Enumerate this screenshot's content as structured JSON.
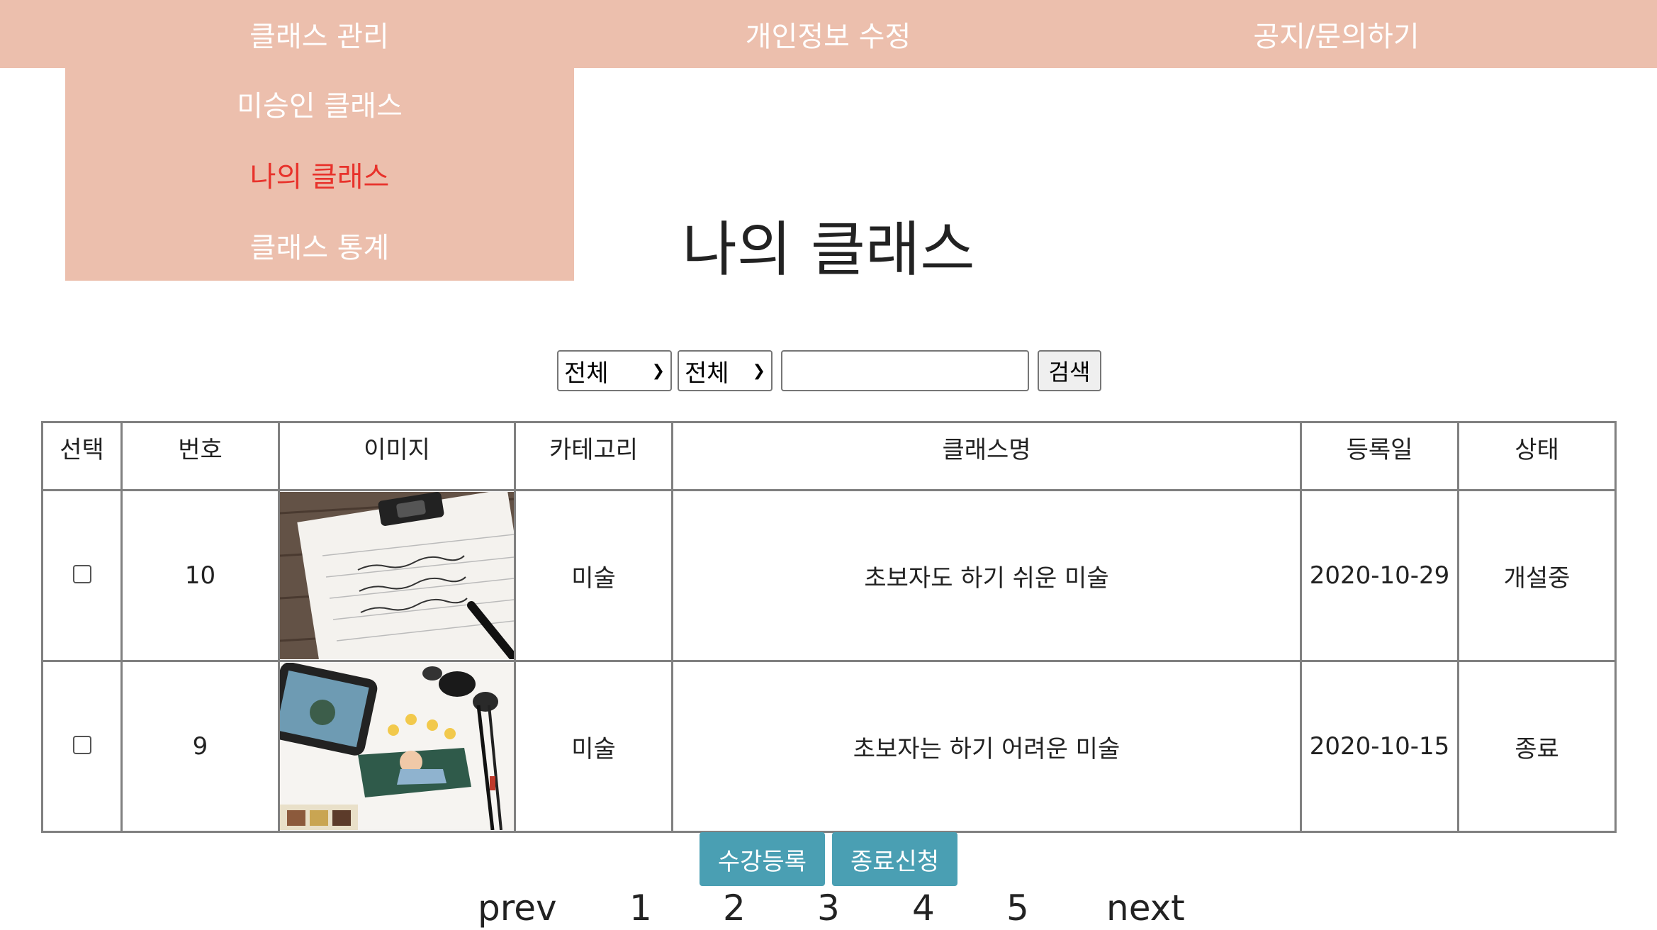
{
  "nav": {
    "items": [
      {
        "label": "클래스 관리"
      },
      {
        "label": "개인정보 수정"
      },
      {
        "label": "공지/문의하기"
      }
    ],
    "dropdown": [
      {
        "label": "미승인 클래스"
      },
      {
        "label": "나의 클래스"
      },
      {
        "label": "클래스 통계"
      }
    ]
  },
  "page": {
    "title": "나의 클래스"
  },
  "search": {
    "filter1": "전체",
    "filter2": "전체",
    "query": "",
    "button": "검색"
  },
  "table": {
    "headers": [
      "선택",
      "번호",
      "이미지",
      "카테고리",
      "클래스명",
      "등록일",
      "상태"
    ],
    "rows": [
      {
        "no": "10",
        "category": "미술",
        "name": "초보자도 하기 쉬운 미술",
        "date": "2020-10-29",
        "status": "개설중",
        "image": "calligraphy-clipboard"
      },
      {
        "no": "9",
        "category": "미술",
        "name": "초보자는 하기 어려운 미술",
        "date": "2020-10-15",
        "status": "종료",
        "image": "watercolor-illustration"
      }
    ]
  },
  "actions": {
    "enroll": "수강등록",
    "close_request": "종료신청"
  },
  "pager": {
    "prev": "prev",
    "pages": [
      "1",
      "2",
      "3",
      "4",
      "5"
    ],
    "next": "next"
  },
  "colors": {
    "nav_bg": "#ecbfad",
    "active_menu": "#e8322b",
    "action_btn": "#4a9fb3"
  }
}
